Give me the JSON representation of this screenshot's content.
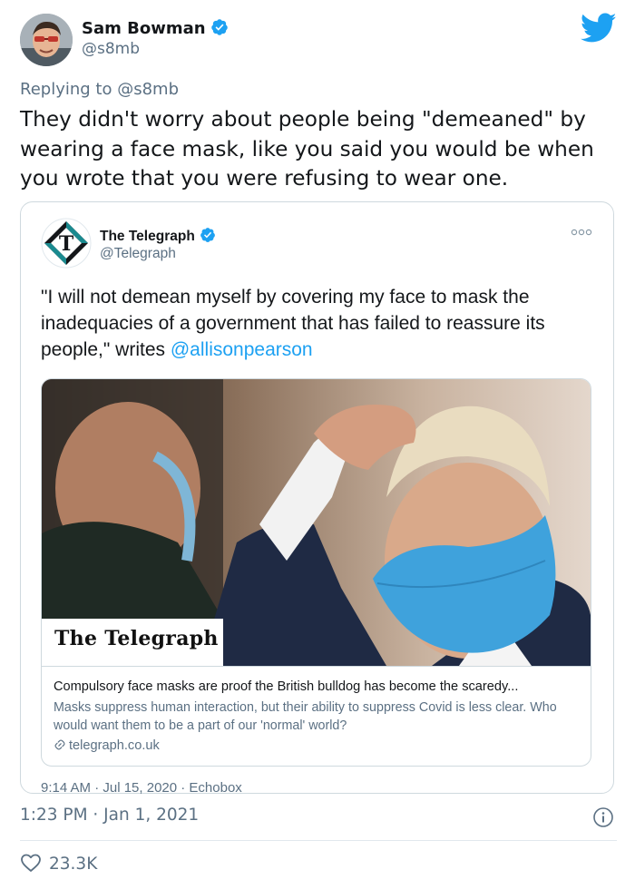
{
  "author": {
    "name": "Sam Bowman",
    "handle": "@s8mb"
  },
  "replying": {
    "prefix": "Replying to ",
    "to": "@s8mb"
  },
  "tweet": {
    "text": "They didn't worry about people being \"demeaned\" by wearing a face mask, like you said you would be when you wrote that you were refusing to wear one.",
    "timestamp": "1:23 PM · Jan 1, 2021",
    "likes": "23.3K"
  },
  "quoted": {
    "name": "The Telegraph",
    "handle": "@Telegraph",
    "text_main": "\"I will not demean myself by covering my face to mask the inadequacies of a government that has failed to reassure its people,\" writes ",
    "mention": "@allisonpearson",
    "meta": "9:14 AM · Jul 15, 2020 · Echobox",
    "link_card": {
      "brand": "The Telegraph",
      "title": "Compulsory face masks are proof the British bulldog has become the scaredy...",
      "description": "Masks suppress human interaction, but their ability to suppress Covid is less clear. Who would want them to be a part of our 'normal' world?",
      "domain": "telegraph.co.uk"
    }
  },
  "colors": {
    "twitter_blue": "#1da1f2",
    "secondary_text": "#5b7083",
    "border": "#cfd9de",
    "mask_blue": "#3fa2dc"
  },
  "icons": [
    "verified-badge-icon",
    "twitter-bird-icon",
    "more-dots-icon",
    "link-icon",
    "info-icon",
    "heart-icon"
  ]
}
